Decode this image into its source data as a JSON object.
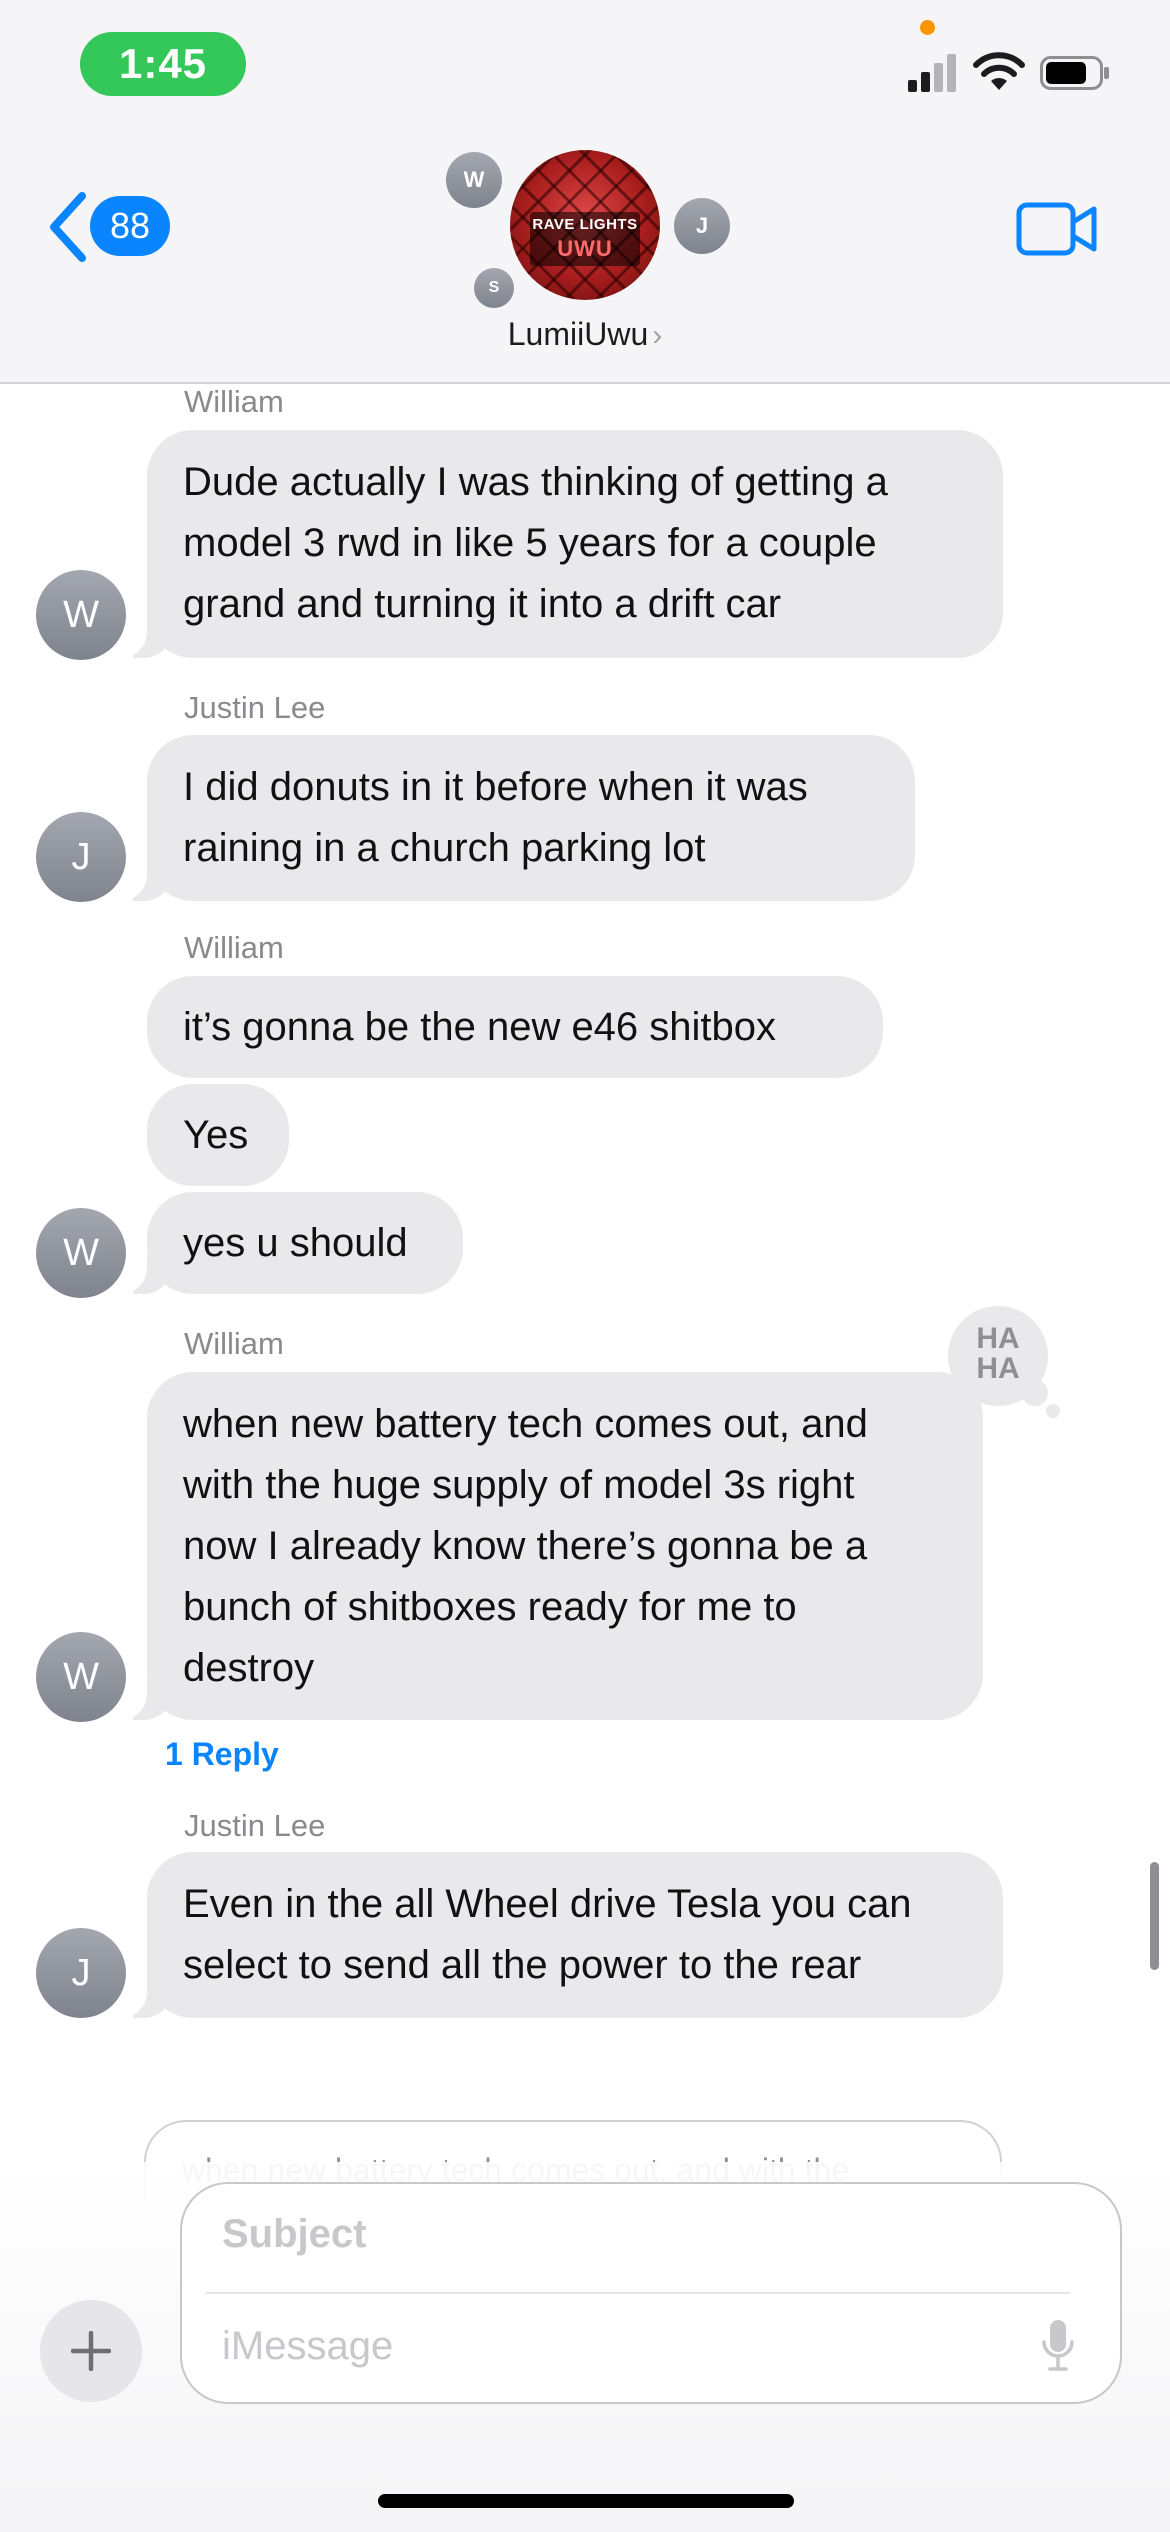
{
  "status_bar": {
    "time": "1:45"
  },
  "header": {
    "back_count": "88",
    "group_name": "LumiiUwu",
    "photo_text_line1": "RAVE LIGHTS",
    "photo_text_line2": "UWU",
    "member_initials": [
      "W",
      "J",
      "S"
    ]
  },
  "messages": [
    {
      "sender": "William",
      "avatar": "W",
      "lines": [
        "Dude actually I was thinking of getting a",
        "model 3 rwd in like 5 years for a couple",
        "grand and turning it into a drift car"
      ]
    },
    {
      "sender": "Justin Lee",
      "avatar": "J",
      "lines": [
        "I did donuts in it before when it was",
        "raining in a church parking lot"
      ]
    },
    {
      "sender": "William",
      "avatar": "W",
      "lines": [
        "it’s gonna be the new e46 shitbox"
      ]
    },
    {
      "lines": [
        "Yes"
      ]
    },
    {
      "lines": [
        "yes u should"
      ]
    },
    {
      "sender": "William",
      "avatar": "W",
      "tapback": "HA HA",
      "lines": [
        "when new battery tech comes out, and",
        "with the huge supply of model 3s right",
        "now I already know there’s gonna be a",
        "bunch of shitboxes ready for me to",
        "destroy"
      ]
    },
    {
      "sender": "Justin Lee",
      "avatar": "J",
      "lines": [
        "Even in the all Wheel drive Tesla you can",
        "select to send all the power to the rear"
      ]
    }
  ],
  "thread": {
    "reply_label": "1 Reply"
  },
  "reply_preview": {
    "text": "when new battery tech comes out, and with the"
  },
  "composer": {
    "subject_placeholder": "Subject",
    "message_placeholder": "iMessage"
  },
  "colors": {
    "bubble": "#e9e9eb",
    "accent": "#0a84ff",
    "time_pill": "#34c759"
  }
}
